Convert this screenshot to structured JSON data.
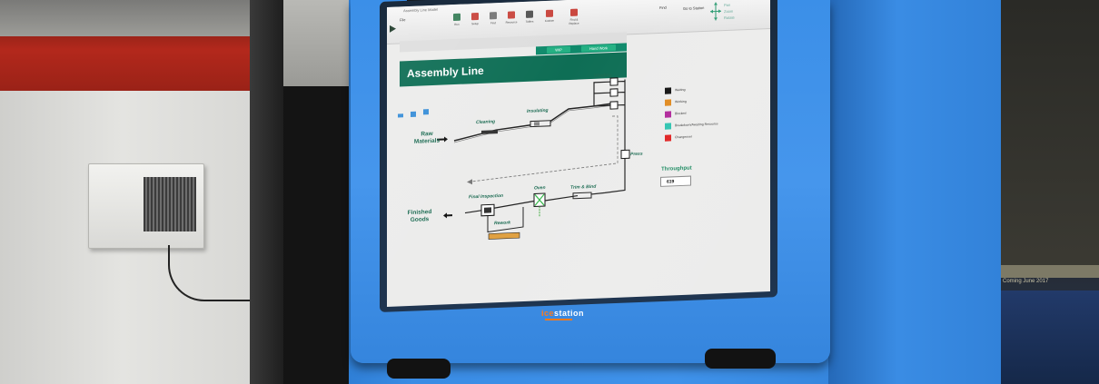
{
  "window": {
    "title": "Assembly Line Model",
    "file_tab": "File",
    "ribbon_items": [
      "Run",
      "Setup",
      "Find",
      "Resource",
      "Tables",
      "Custom",
      "Find & Replace"
    ],
    "find_label": "Find",
    "goto_label": "Go to Station"
  },
  "nav": {
    "labels": [
      "Pan",
      "Zoom",
      "Rotate"
    ]
  },
  "toolbar": {
    "wip_label": "WIP",
    "hand_label": "Hand Work"
  },
  "page": {
    "title": "Assembly Line"
  },
  "stations": {
    "raw_materials": "Raw\nMaterials",
    "cleaning": "Cleaning",
    "insulating": "Insulating",
    "winding": "Winding",
    "press": "Press",
    "trim_bind": "Trim & Bind",
    "oven": "Oven",
    "final_inspection": "Final Inspection",
    "rework": "Rework",
    "finished_goods": "Finished\nGoods"
  },
  "legend": [
    {
      "label": "Waiting",
      "color": "#111111"
    },
    {
      "label": "Working",
      "color": "#e08a1e"
    },
    {
      "label": "Blocked",
      "color": "#b0279a"
    },
    {
      "label": "Breakdown/Awaiting Resource",
      "color": "#2ec4b0"
    },
    {
      "label": "Changeover",
      "color": "#e02020"
    }
  ],
  "throughput": {
    "label": "Throughput",
    "value": "619"
  },
  "kiosk": {
    "brand_a": "ice",
    "brand_b": "station"
  },
  "background": {
    "sign_text": "Coming June 2017"
  }
}
